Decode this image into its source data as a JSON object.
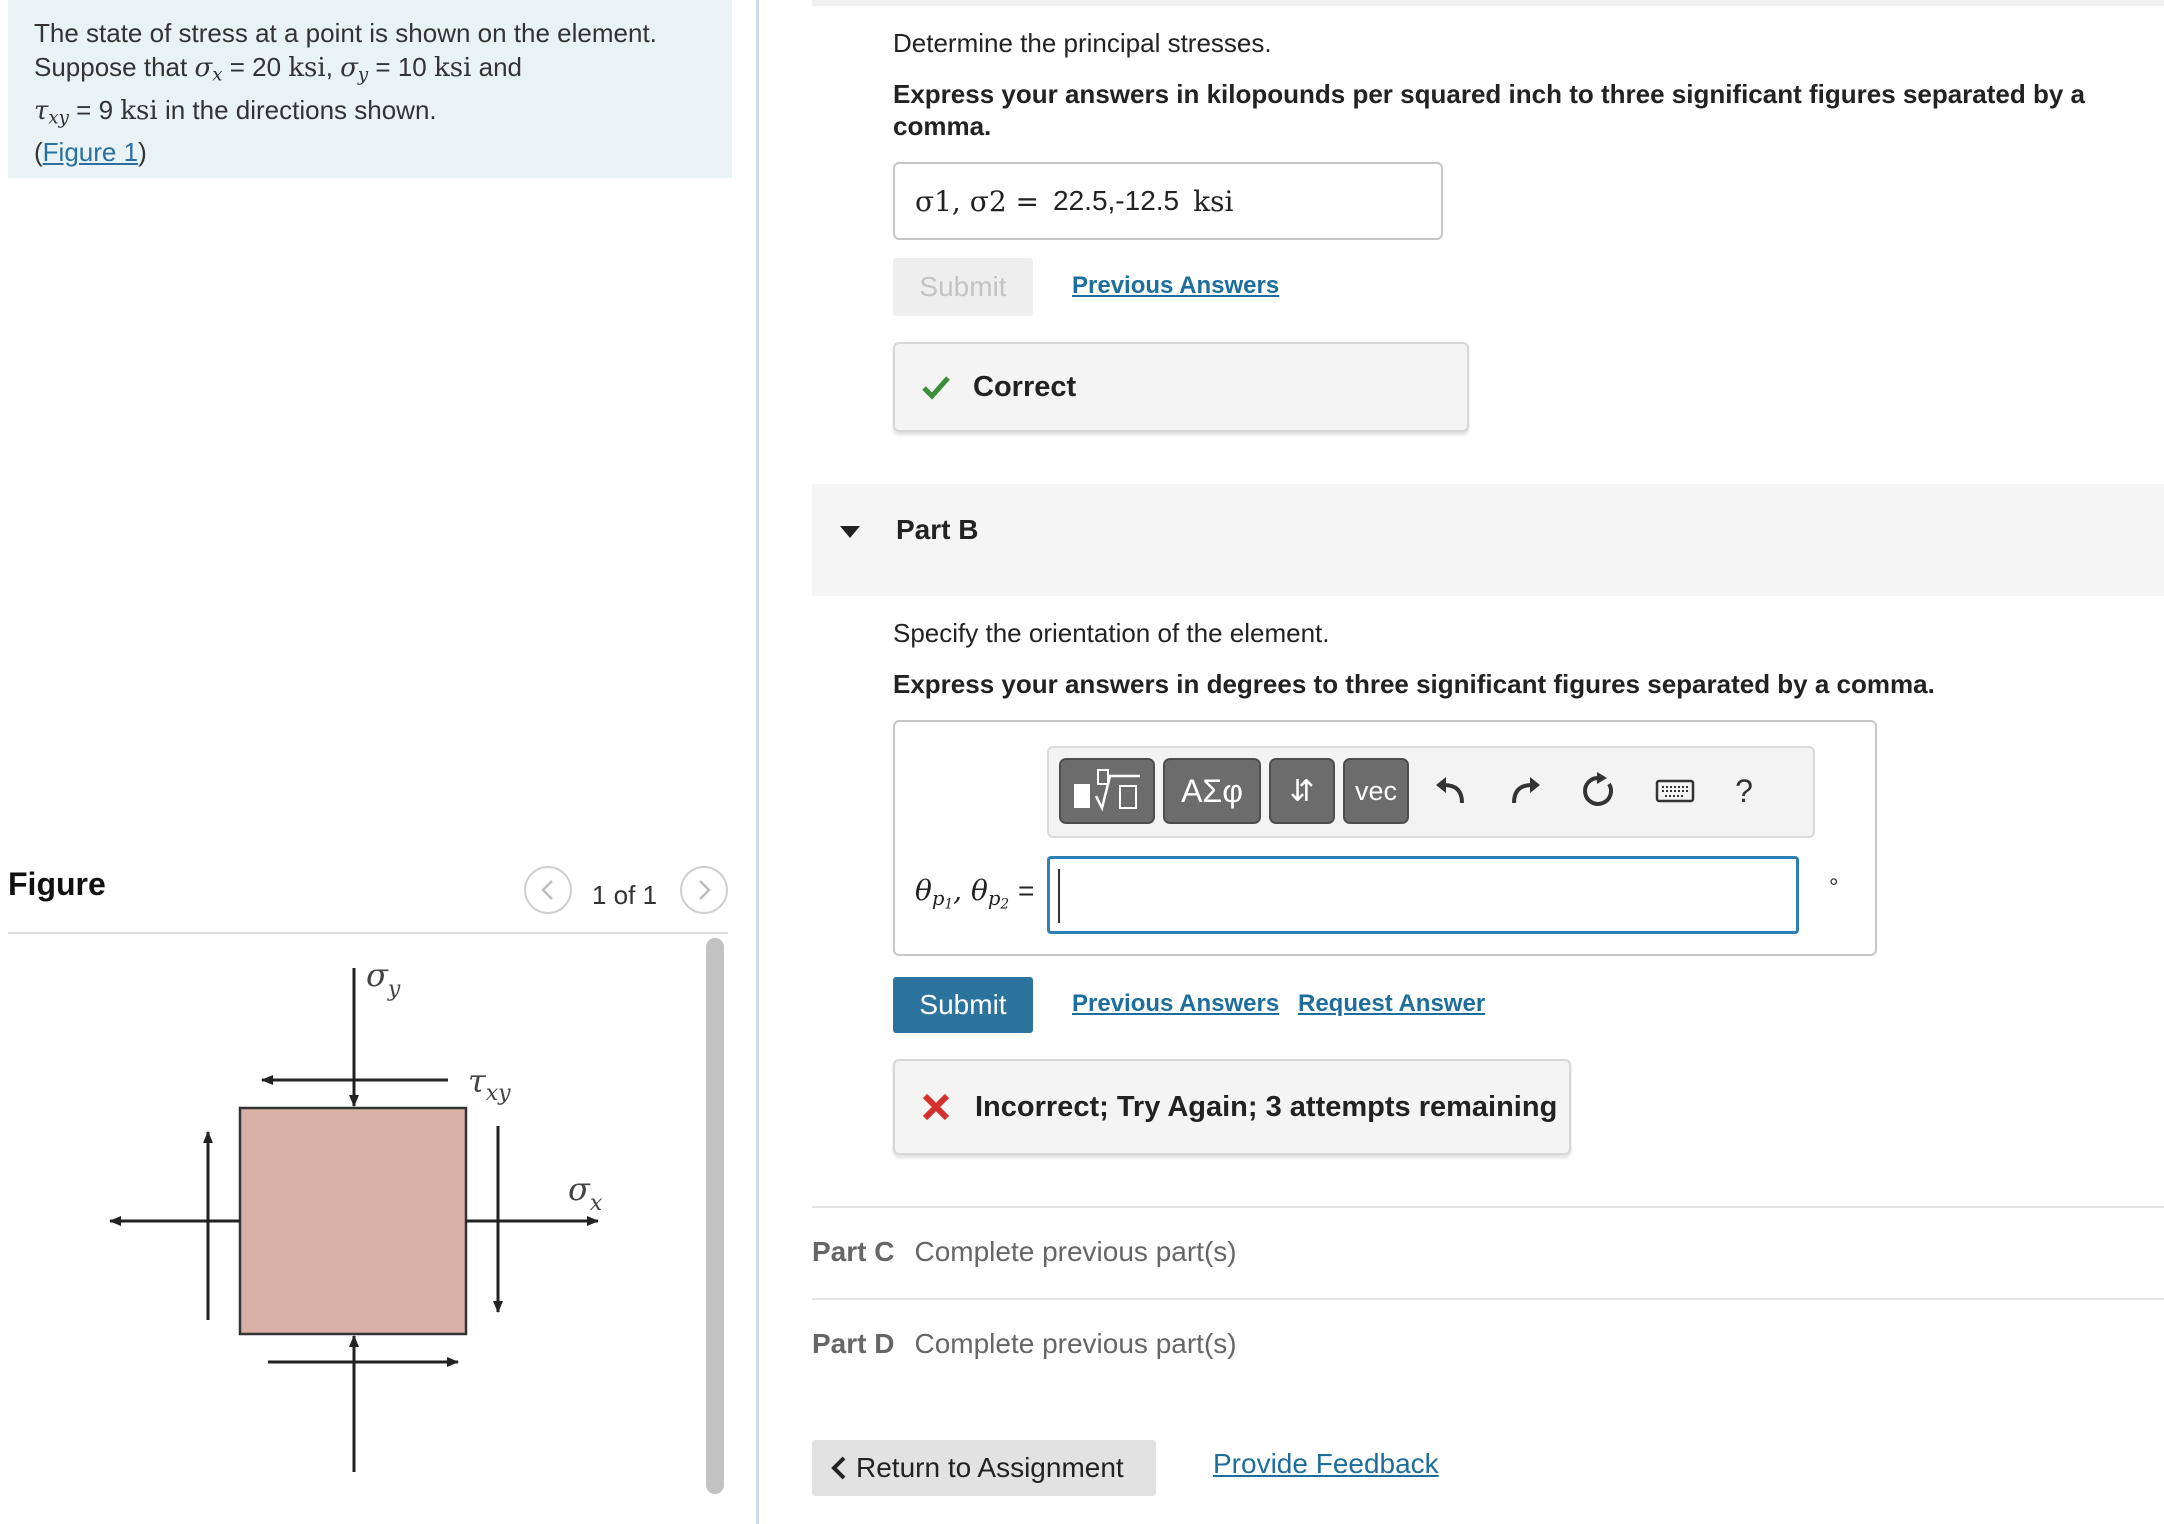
{
  "problem": {
    "line1": "The state of stress at a point is shown on the element.",
    "suppose": "Suppose that",
    "sx_sym": "σ",
    "sx_sub": "x",
    "sx_val": "= 20",
    "unit": "ksi",
    "sy_sym": "σ",
    "sy_sub": "y",
    "sy_val": "= 10",
    "and": "and",
    "txy_sym": "τ",
    "txy_sub": "xy",
    "txy_val": "= 9",
    "directions": "in the directions shown.",
    "figure_link": "Figure 1"
  },
  "figure": {
    "heading": "Figure",
    "counter": "1 of 1",
    "label_sigma_y": "σ",
    "label_sigma_y_sub": "y",
    "label_tau_xy": "τ",
    "label_tau_xy_sub": "xy",
    "label_sigma_x": "σ",
    "label_sigma_x_sub": "x",
    "element_color": "#d8b0a6"
  },
  "part_a": {
    "prompt": "Determine the principal stresses.",
    "instruction": "Express your answers in kilopounds per squared inch to three significant figures separated by a comma.",
    "answer_label": "σ1, σ2 =",
    "answer_value": "22.5,-12.5",
    "answer_unit": "ksi",
    "submit_label": "Submit",
    "previous_answers": "Previous Answers",
    "feedback": "Correct",
    "feedback_color": "#3b8f3b"
  },
  "part_b": {
    "title": "Part B",
    "prompt": "Specify the orientation of the element.",
    "instruction": "Express your answers in degrees to three significant figures separated by a comma.",
    "answer_label_theta": "θ",
    "answer_label_sub1": "p",
    "answer_label_sub1b": "1",
    "answer_label_sub2": "p",
    "answer_label_sub2b": "2",
    "answer_label_eq": "=",
    "answer_value": "",
    "unit": "°",
    "toolbar": {
      "greek": "ΑΣφ",
      "arrows": "⇵",
      "vec": "vec",
      "help": "?"
    },
    "submit_label": "Submit",
    "previous_answers": "Previous Answers",
    "request_answer": "Request Answer",
    "feedback": "Incorrect; Try Again; 3 attempts remaining",
    "feedback_color": "#d62f2f"
  },
  "part_c": {
    "title": "Part C",
    "status": "Complete previous part(s)"
  },
  "part_d": {
    "title": "Part D",
    "status": "Complete previous part(s)"
  },
  "footer": {
    "return_label": "Return to Assignment",
    "feedback_link": "Provide Feedback"
  }
}
